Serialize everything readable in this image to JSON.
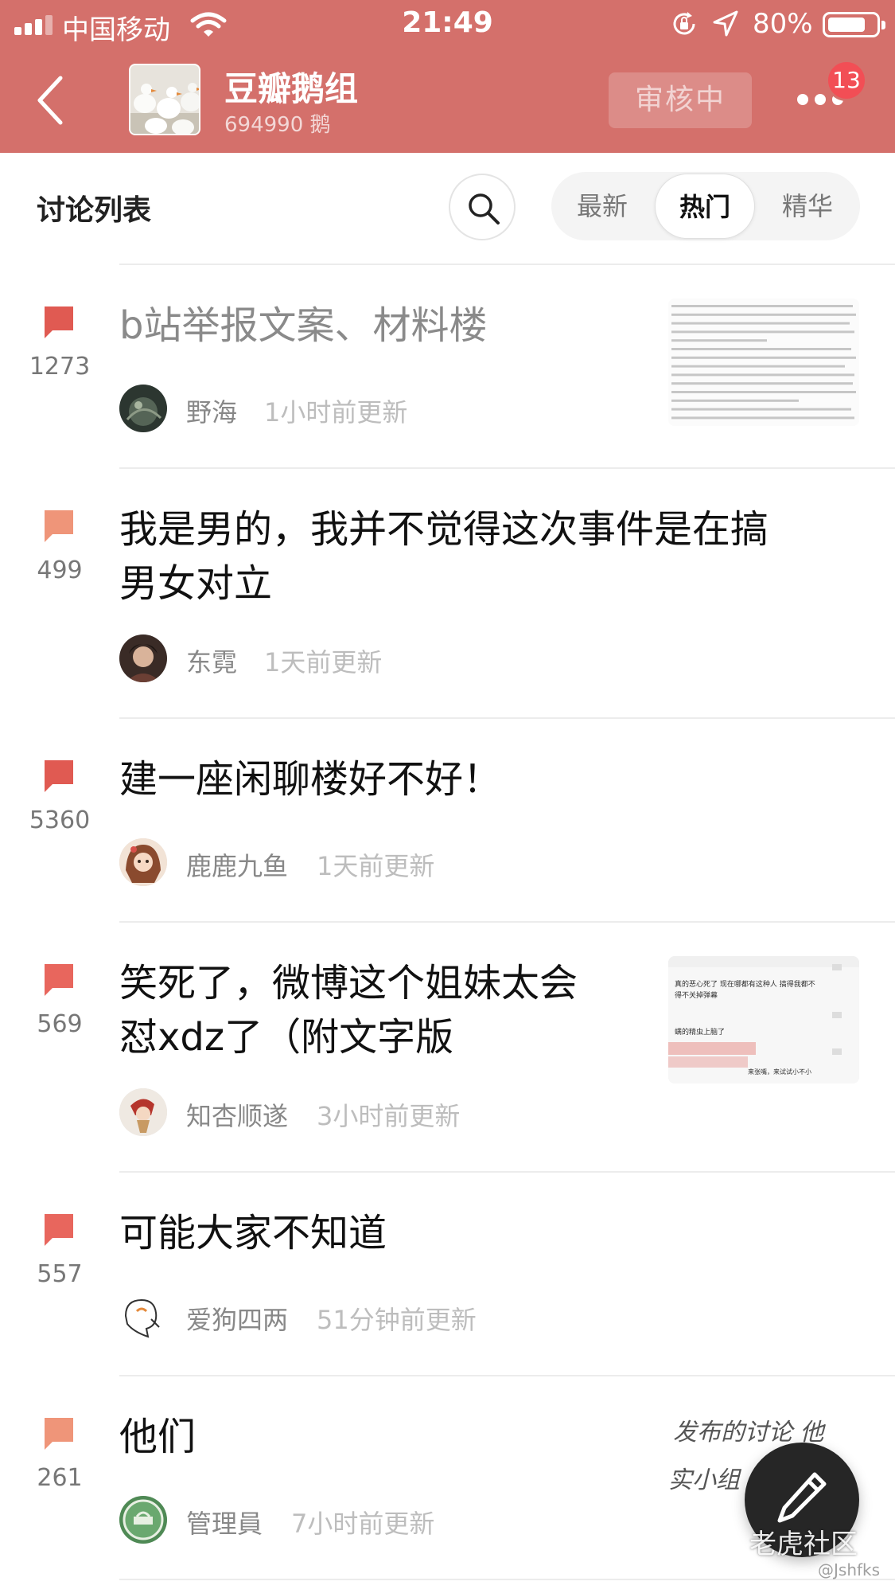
{
  "status_bar": {
    "carrier": "中国移动",
    "time": "21:49",
    "battery": "80%",
    "battery_level": 0.8
  },
  "nav": {
    "group_name": "豆瓣鹅组",
    "member_count": "694990 鹅",
    "review_label": "审核中",
    "notifications": "13"
  },
  "toolbar": {
    "list_title": "讨论列表",
    "tabs": [
      {
        "label": "最新",
        "active": false
      },
      {
        "label": "热门",
        "active": true
      },
      {
        "label": "精华",
        "active": false
      }
    ]
  },
  "topics": [
    {
      "count": "1273",
      "bubble_color": "#e05a52",
      "title_lines": [
        "b站举报文案、材料楼"
      ],
      "read": true,
      "author": "野海",
      "updated": "1小时前更新"
    },
    {
      "count": "499",
      "bubble_color": "#ef9579",
      "title_lines": [
        "我是男的，我并不觉得这次事件是在搞",
        "男女对立"
      ],
      "read": false,
      "author": "东霓",
      "updated": "1天前更新"
    },
    {
      "count": "5360",
      "bubble_color": "#e05a52",
      "title_lines": [
        "建一座闲聊楼好不好！"
      ],
      "read": false,
      "author": "鹿鹿九鱼",
      "updated": "1天前更新"
    },
    {
      "count": "569",
      "bubble_color": "#e8665d",
      "title_lines": [
        "笑死了，微博这个姐妹太会",
        "怼xdz了（附文字版"
      ],
      "read": false,
      "author": "知杏顺遂",
      "updated": "3小时前更新"
    },
    {
      "count": "557",
      "bubble_color": "#e8665d",
      "title_lines": [
        "可能大家不知道"
      ],
      "read": false,
      "author": "爱狗四两",
      "updated": "51分钟前更新"
    },
    {
      "count": "261",
      "bubble_color": "#ef9579",
      "title_lines": [
        "他们"
      ],
      "read": false,
      "author": "管理員",
      "updated": "7小时前更新"
    }
  ],
  "thumb_text": {
    "chat_lines": [
      "真的恶心死了 现在哪都有这种人 搞得我都不",
      "得不关掉弹幕",
      "螨的精虫上脑了",
      "来张嘴，来试试小不小"
    ],
    "handwriting": [
      "发布的讨论 他",
      "实小组"
    ]
  },
  "watermark": {
    "text": "老虎社区",
    "handle": "@Jshfks"
  }
}
